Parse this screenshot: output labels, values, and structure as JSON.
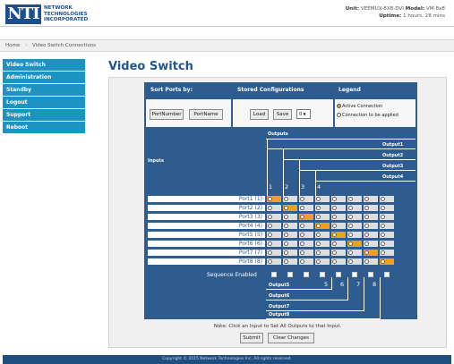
{
  "header": {
    "logo_mark": "NTI",
    "logo_line1": "NETWORK",
    "logo_line2": "TECHNOLOGIES",
    "logo_line3": "INCORPORATED",
    "unit_label": "Unit:",
    "unit_value": "VEEMUX-8X8-DVI",
    "model_label": "Model:",
    "model_value": "VM-8x8",
    "uptime_label": "Uptime:",
    "uptime_value": "1 hours, 28 mins"
  },
  "breadcrumb": {
    "home": "Home",
    "current": "Video Switch Connections"
  },
  "sidebar": {
    "items": [
      {
        "label": "Video Switch"
      },
      {
        "label": "Administration"
      },
      {
        "label": "Standby"
      },
      {
        "label": "Logout"
      },
      {
        "label": "Support"
      },
      {
        "label": "Reboot"
      }
    ]
  },
  "page": {
    "title": "Video Switch",
    "note": "Note: Click an Input to Set All Outputs to that Input.",
    "submit_label": "Submit",
    "clear_label": "Clear Changes"
  },
  "controls": {
    "sort_header": "Sort Ports by:",
    "port_number_label": "PortNumber",
    "port_name_label": "PortName",
    "stored_header": "Stored Configurations",
    "load_label": "Load",
    "save_label": "Save",
    "config_value": "0",
    "legend_header": "Legend",
    "legend_active": "Active Connection",
    "legend_apply": "Connection to be applied"
  },
  "matrix": {
    "outputs_label": "Outputs",
    "inputs_label": "Inputs",
    "sequence_label": "Sequence Enabled",
    "top_outputs": [
      "Output1",
      "Output2",
      "Output3",
      "Output4"
    ],
    "bottom_outputs": [
      "Output5",
      "Output6",
      "Output7",
      "Output8"
    ],
    "column_numbers": [
      "1",
      "2",
      "3",
      "4",
      "5",
      "6",
      "7",
      "8"
    ],
    "rows": [
      {
        "label": "Port1 (1)",
        "selected": 0
      },
      {
        "label": "Port2 (2)",
        "selected": 1
      },
      {
        "label": "Port3 (3)",
        "selected": 2
      },
      {
        "label": "Port4 (4)",
        "selected": 3
      },
      {
        "label": "Port5 (5)",
        "selected": 4
      },
      {
        "label": "Port6 (6)",
        "selected": 5
      },
      {
        "label": "Port7 (7)",
        "selected": 6
      },
      {
        "label": "Port8 (8)",
        "selected": 7
      }
    ]
  },
  "footer": {
    "text": "Copyright © 2015 Network Technologies Inc. All rights reserved."
  },
  "colors": {
    "panel": "#2f5c8f",
    "sidebar": "#1c93c2",
    "selected_cell": "#f0a020",
    "footer": "#1e4d80"
  }
}
